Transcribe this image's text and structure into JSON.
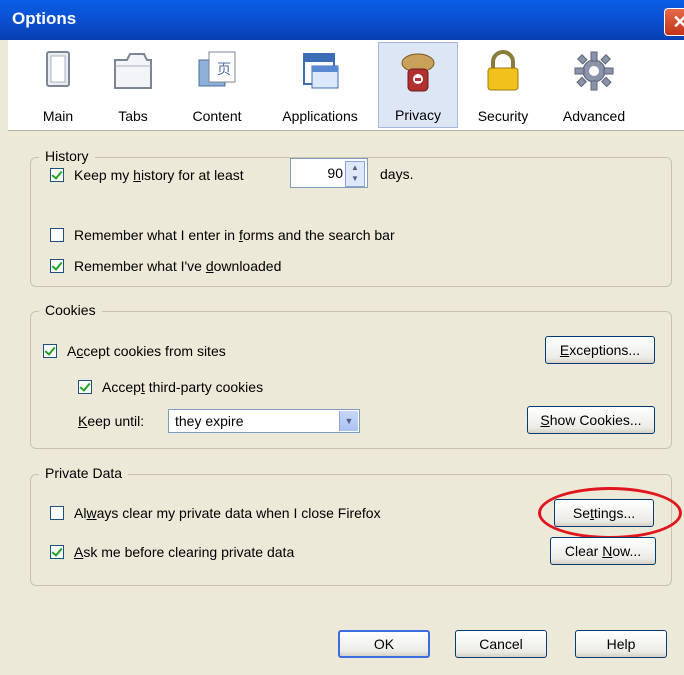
{
  "window": {
    "title": "Options"
  },
  "tabs": [
    {
      "label": "Main",
      "icon": "main-window-icon"
    },
    {
      "label": "Tabs",
      "icon": "tabs-icon"
    },
    {
      "label": "Content",
      "icon": "content-icon"
    },
    {
      "label": "Applications",
      "icon": "applications-icon"
    },
    {
      "label": "Privacy",
      "icon": "privacy-mask-icon",
      "selected": true
    },
    {
      "label": "Security",
      "icon": "padlock-icon"
    },
    {
      "label": "Advanced",
      "icon": "gear-icon"
    }
  ],
  "history": {
    "legend": "History",
    "keep_prefix": "Keep my ",
    "keep_u": "h",
    "keep_mid": "istory for at least",
    "days_value": "90",
    "days_suffix": "days.",
    "forms_prefix": "Remember what I enter in ",
    "forms_u": "f",
    "forms_rest": "orms and the search bar",
    "downloads_prefix": "Remember what I've ",
    "downloads_u": "d",
    "downloads_rest": "ownloaded"
  },
  "cookies": {
    "legend": "Cookies",
    "accept_a": "A",
    "accept_u": "c",
    "accept_rest": "cept cookies from sites",
    "third_pre": "Accep",
    "third_u": "t",
    "third_rest": " third-party cookies",
    "keep_u": "K",
    "keep_rest": "eep until:",
    "keep_value": "they expire",
    "exceptions_u": "E",
    "exceptions_rest": "xceptions...",
    "show_u": "S",
    "show_rest": "how Cookies..."
  },
  "private_data": {
    "legend": "Private Data",
    "always_pre": "Al",
    "always_u": "w",
    "always_rest": "ays clear my private data when I close Firefox",
    "ask_u": "A",
    "ask_rest": "sk me before clearing private data",
    "settings_pre": "Se",
    "settings_u": "t",
    "settings_rest": "tings...",
    "clear_pre": "Clear ",
    "clear_u": "N",
    "clear_rest": "ow..."
  },
  "footer": {
    "ok": "OK",
    "cancel": "Cancel",
    "help": "Help"
  },
  "colors": {
    "accent_highlight": "#e0161c",
    "titlebar": "#0a5ee6",
    "check": "#21a121"
  }
}
